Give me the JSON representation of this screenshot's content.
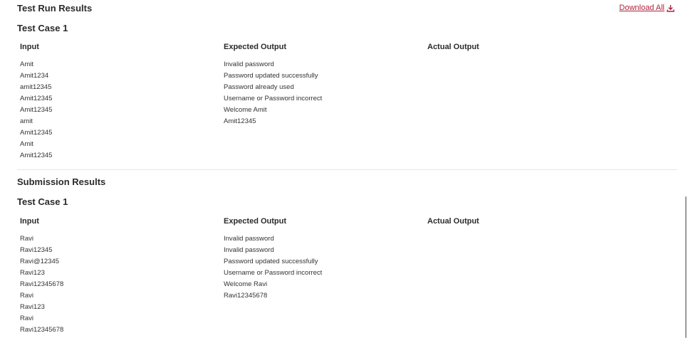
{
  "run_results": {
    "title": "Test Run Results",
    "download_label": "Download All",
    "case_title": "Test Case 1",
    "columns": {
      "input": "Input",
      "expected": "Expected Output",
      "actual": "Actual Output"
    },
    "inputs": [
      "Amit",
      "Amit1234",
      "amit12345",
      "Amit12345",
      "Amit12345",
      "amit",
      "Amit12345",
      "Amit",
      "Amit12345"
    ],
    "expected": [
      "Invalid password",
      "Password updated successfully",
      "Password already used",
      "Username or Password incorrect",
      "Welcome Amit",
      "Amit12345"
    ],
    "actual": []
  },
  "submission_results": {
    "title": "Submission Results",
    "case_title": "Test Case 1",
    "columns": {
      "input": "Input",
      "expected": "Expected Output",
      "actual": "Actual Output"
    },
    "inputs": [
      "Ravi",
      "Ravi12345",
      "Ravi@12345",
      "Ravi123",
      "Ravi12345678",
      "Ravi",
      "Ravi123",
      "Ravi",
      "Ravi12345678"
    ],
    "expected": [
      "Invalid password",
      "Invalid password",
      "Password updated successfully",
      "Username or Password incorrect",
      "Welcome Ravi",
      "Ravi12345678"
    ],
    "actual": []
  },
  "icons": {
    "download": "download-icon"
  },
  "colors": {
    "link": "#b0203a",
    "text": "#222222",
    "divider": "#e6e6e6"
  }
}
